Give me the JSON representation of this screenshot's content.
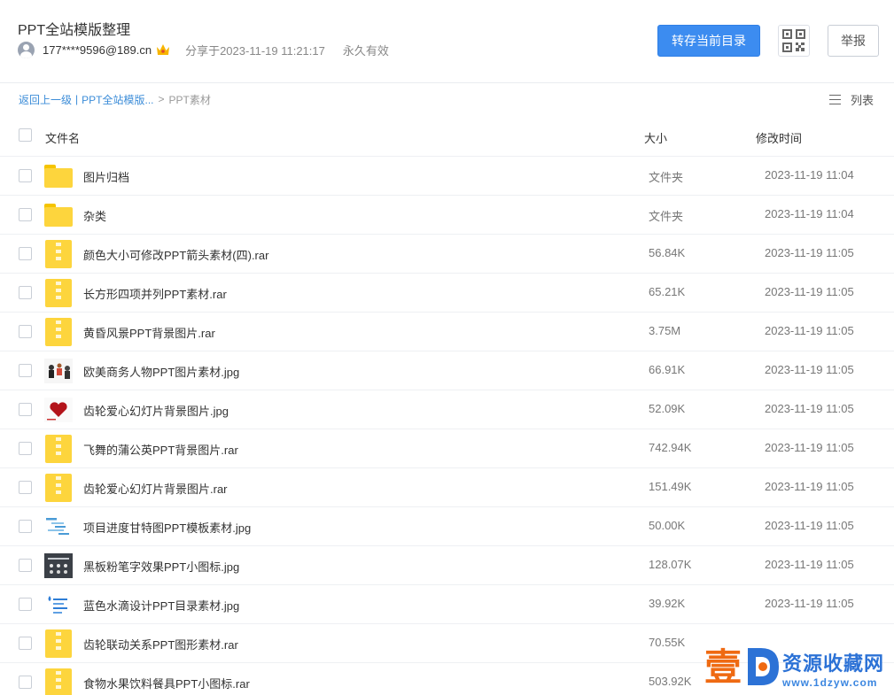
{
  "header": {
    "title": "PPT全站模版整理",
    "username": "177****9596@189.cn",
    "shared_at": "分享于2023-11-19 11:21:17",
    "validity": "永久有效",
    "save_button": "转存当前目录",
    "report_button": "举报"
  },
  "breadcrumb": {
    "back": "返回上一级",
    "separator": "|",
    "parent": "PPT全站模版...",
    "arrow": ">",
    "current": "PPT素材"
  },
  "view_mode": "列表",
  "table": {
    "col_name": "文件名",
    "col_size": "大小",
    "col_time": "修改时间"
  },
  "files": [
    {
      "name": "图片归档",
      "size": "文件夹",
      "time": "2023-11-19 11:04",
      "icon": "folder-icon"
    },
    {
      "name": "杂类",
      "size": "文件夹",
      "time": "2023-11-19 11:04",
      "icon": "folder-icon"
    },
    {
      "name": "颜色大小可修改PPT箭头素材(四).rar",
      "size": "56.84K",
      "time": "2023-11-19 11:05",
      "icon": "zip-icon"
    },
    {
      "name": "长方形四项并列PPT素材.rar",
      "size": "65.21K",
      "time": "2023-11-19 11:05",
      "icon": "zip-icon"
    },
    {
      "name": "黄昏风景PPT背景图片.rar",
      "size": "3.75M",
      "time": "2023-11-19 11:05",
      "icon": "zip-icon"
    },
    {
      "name": "欧美商务人物PPT图片素材.jpg",
      "size": "66.91K",
      "time": "2023-11-19 11:05",
      "icon": "image-thumbnail"
    },
    {
      "name": "齿轮爱心幻灯片背景图片.jpg",
      "size": "52.09K",
      "time": "2023-11-19 11:05",
      "icon": "image-thumbnail"
    },
    {
      "name": "飞舞的蒲公英PPT背景图片.rar",
      "size": "742.94K",
      "time": "2023-11-19 11:05",
      "icon": "zip-icon"
    },
    {
      "name": "齿轮爱心幻灯片背景图片.rar",
      "size": "151.49K",
      "time": "2023-11-19 11:05",
      "icon": "zip-icon"
    },
    {
      "name": "项目进度甘特图PPT模板素材.jpg",
      "size": "50.00K",
      "time": "2023-11-19 11:05",
      "icon": "image-thumbnail"
    },
    {
      "name": "黑板粉笔字效果PPT小图标.jpg",
      "size": "128.07K",
      "time": "2023-11-19 11:05",
      "icon": "image-thumbnail"
    },
    {
      "name": "蓝色水滴设计PPT目录素材.jpg",
      "size": "39.92K",
      "time": "2023-11-19 11:05",
      "icon": "image-thumbnail"
    },
    {
      "name": "齿轮联动关系PPT图形素材.rar",
      "size": "70.55K",
      "time": "",
      "icon": "zip-icon"
    },
    {
      "name": "食物水果饮料餐具PPT小图标.rar",
      "size": "503.92K",
      "time": "",
      "icon": "zip-icon"
    }
  ],
  "watermark": {
    "big_char": "壹",
    "site_name": "资源收藏网",
    "url": "www.1dzyw.com"
  },
  "colors": {
    "primary": "#3c8cf0",
    "link": "#3b8cd8",
    "folder": "#fdd53d",
    "watermark_orange": "#ef6a12",
    "watermark_blue": "#2c72d6"
  }
}
